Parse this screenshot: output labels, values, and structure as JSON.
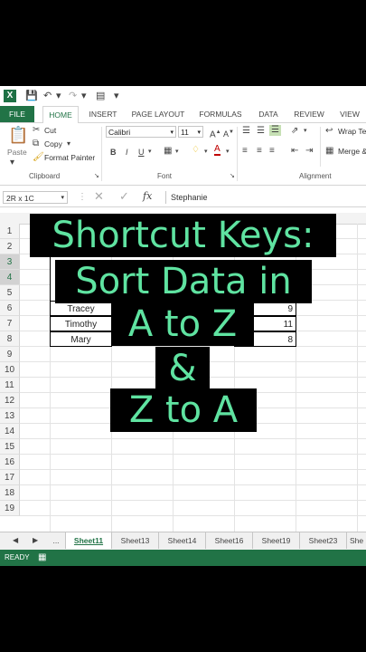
{
  "app": {
    "logo_letter": "X"
  },
  "ribbon_tabs": [
    "FILE",
    "HOME",
    "INSERT",
    "PAGE LAYOUT",
    "FORMULAS",
    "DATA",
    "REVIEW",
    "VIEW"
  ],
  "clipboard": {
    "paste": "Paste",
    "cut": "Cut",
    "copy": "Copy",
    "format_painter": "Format Painter",
    "group": "Clipboard"
  },
  "font": {
    "name": "Calibri",
    "size": "11",
    "group": "Font",
    "bold": "B",
    "italic": "I",
    "underline": "U"
  },
  "alignment": {
    "wrap": "Wrap Te",
    "merge": "Merge &",
    "group": "Alignment"
  },
  "formula_bar": {
    "name_box": "2R x 1C",
    "fx": "fx",
    "value": "Stephanie"
  },
  "rows": [
    "1",
    "2",
    "3",
    "4",
    "5",
    "6",
    "7",
    "8",
    "9",
    "10",
    "11",
    "12",
    "13",
    "14",
    "15",
    "16",
    "17",
    "18",
    "19"
  ],
  "data_rows": [
    {
      "name": "Tracey",
      "value": "9"
    },
    {
      "name": "Timothy",
      "value": "11"
    },
    {
      "name": "Mary",
      "value": "8"
    }
  ],
  "sheets": [
    "...",
    "Sheet11",
    "Sheet13",
    "Sheet14",
    "Sheet16",
    "Sheet19",
    "Sheet23",
    "She"
  ],
  "status": "READY",
  "overlay": {
    "line1": "Shortcut Keys:",
    "line2": "Sort Data in",
    "line3": "A to Z",
    "line4": "&",
    "line5": "Z to A"
  },
  "colors": {
    "excel_green": "#217346",
    "overlay_text": "#5fe3a1"
  }
}
